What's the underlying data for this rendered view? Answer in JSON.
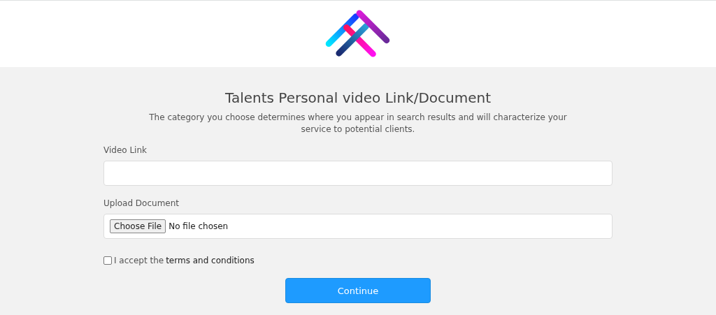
{
  "title": "Talents Personal video Link/Document",
  "description": "The category you choose determines where you appear in search results and will characterize your service to potential clients.",
  "video_link": {
    "label": "Video Link"
  },
  "upload": {
    "label": "Upload Document",
    "button": "Choose File",
    "status": "No file chosen"
  },
  "terms": {
    "checked": false,
    "prefix": "I accept the",
    "link": "terms and conditions"
  },
  "continue_button": "Continue"
}
